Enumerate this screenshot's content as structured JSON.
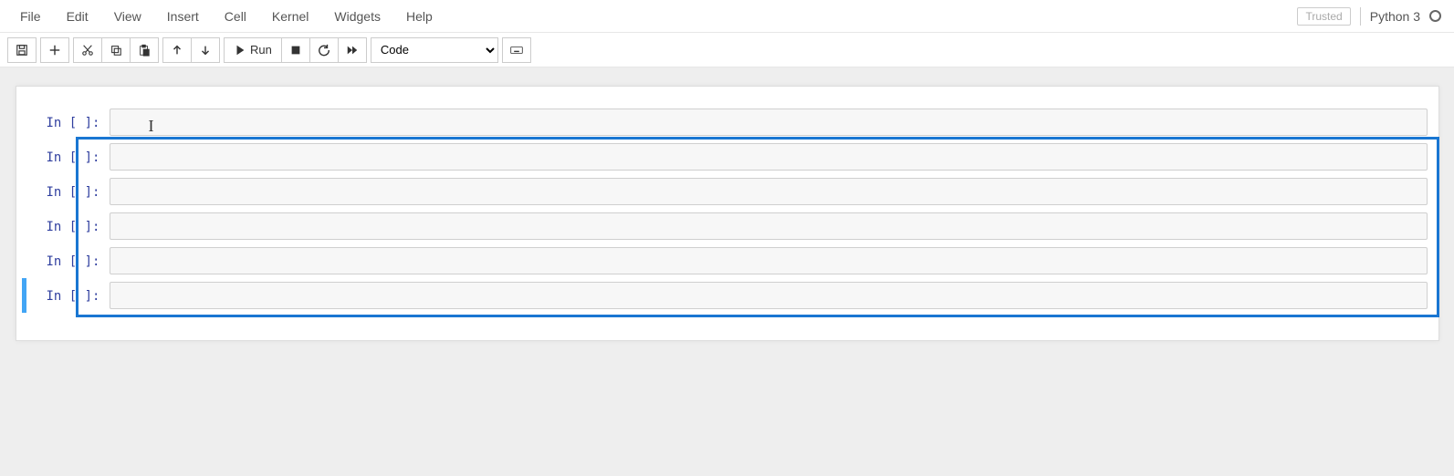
{
  "menubar": {
    "items": [
      "File",
      "Edit",
      "View",
      "Insert",
      "Cell",
      "Kernel",
      "Widgets",
      "Help"
    ],
    "trusted_label": "Trusted",
    "kernel_name": "Python 3"
  },
  "toolbar": {
    "run_label": "Run",
    "cell_type_selected": "Code"
  },
  "cells": [
    {
      "prompt": "In [ ]:",
      "content": "",
      "has_cursor": true,
      "selected": false
    },
    {
      "prompt": "In [ ]:",
      "content": "",
      "has_cursor": false,
      "selected": false
    },
    {
      "prompt": "In [ ]:",
      "content": "",
      "has_cursor": false,
      "selected": false
    },
    {
      "prompt": "In [ ]:",
      "content": "",
      "has_cursor": false,
      "selected": false
    },
    {
      "prompt": "In [ ]:",
      "content": "",
      "has_cursor": false,
      "selected": false
    },
    {
      "prompt": "In [ ]:",
      "content": "",
      "has_cursor": false,
      "selected": true
    }
  ],
  "selection_box": {
    "top_cell": 1,
    "bottom_cell": 5
  }
}
